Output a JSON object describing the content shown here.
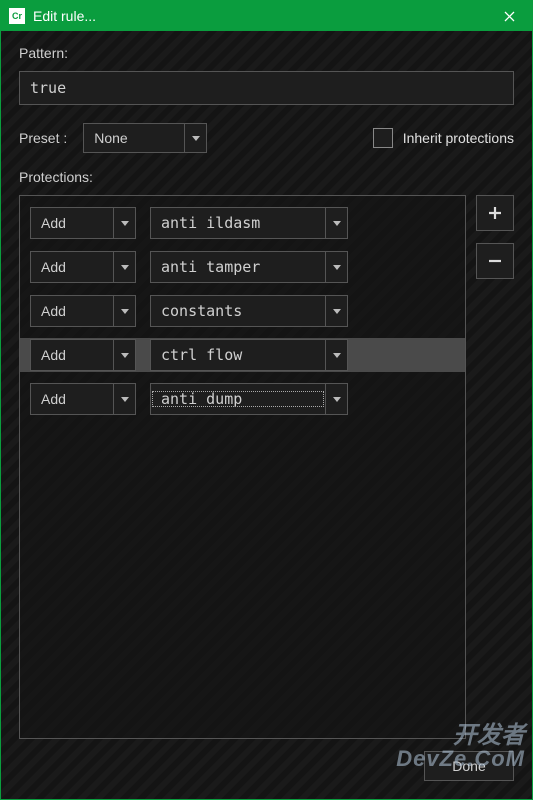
{
  "titlebar": {
    "title": "Edit rule...",
    "icon_label": "Cr"
  },
  "labels": {
    "pattern": "Pattern:",
    "preset": "Preset :",
    "protections": "Protections:",
    "inherit": "Inherit protections"
  },
  "pattern_value": "true",
  "preset_value": "None",
  "inherit_checked": false,
  "protections": [
    {
      "mode": "Add",
      "name": "anti ildasm",
      "selected": false,
      "focused": false
    },
    {
      "mode": "Add",
      "name": "anti tamper",
      "selected": false,
      "focused": false
    },
    {
      "mode": "Add",
      "name": "constants",
      "selected": false,
      "focused": false
    },
    {
      "mode": "Add",
      "name": "ctrl flow",
      "selected": true,
      "focused": false
    },
    {
      "mode": "Add",
      "name": "anti dump",
      "selected": false,
      "focused": true
    }
  ],
  "buttons": {
    "done": "Done",
    "add": "+",
    "remove": "−"
  },
  "watermark": {
    "line1": "开发者",
    "line2": "DevZe.CoM"
  }
}
